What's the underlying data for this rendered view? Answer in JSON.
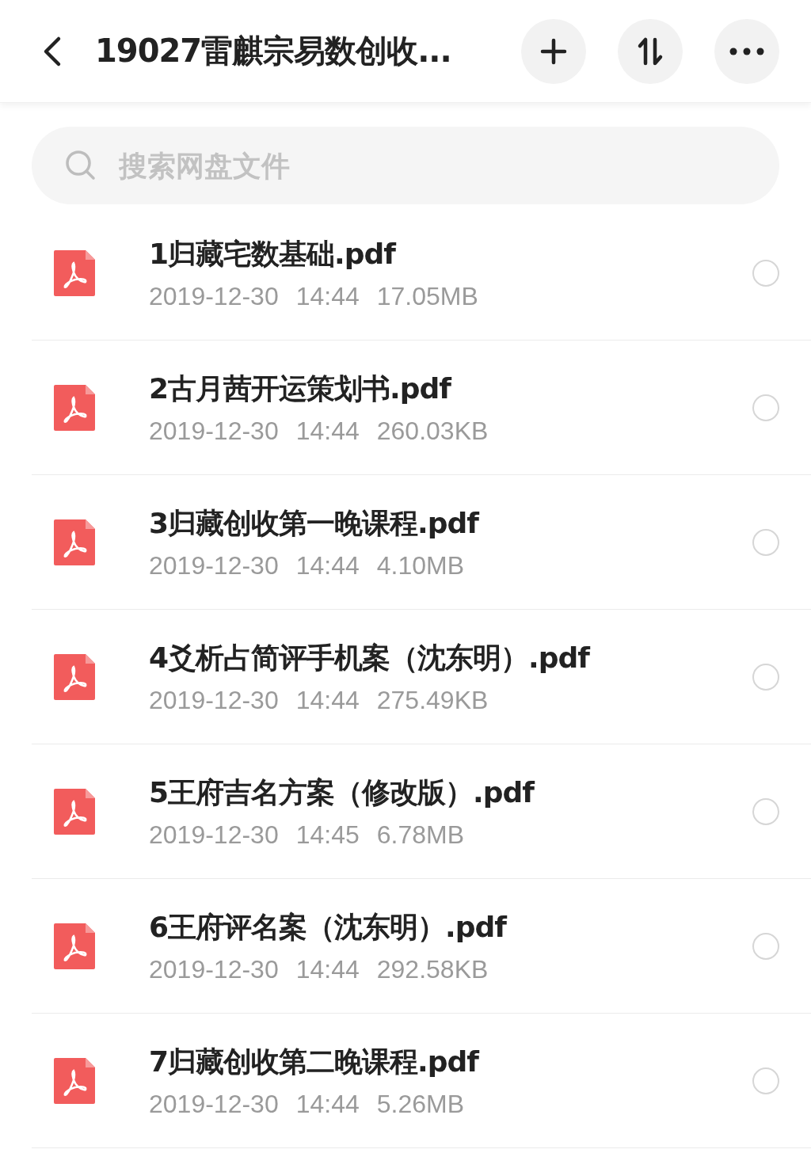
{
  "header": {
    "title": "19027雷麒宗易数创收..."
  },
  "search": {
    "placeholder": "搜索网盘文件"
  },
  "files": [
    {
      "name": "1归藏宅数基础.pdf",
      "date": "2019-12-30",
      "time": "14:44",
      "size": "17.05MB",
      "selected": false
    },
    {
      "name": "2古月茜开运策划书.pdf",
      "date": "2019-12-30",
      "time": "14:44",
      "size": "260.03KB",
      "selected": false
    },
    {
      "name": "3归藏创收第一晚课程.pdf",
      "date": "2019-12-30",
      "time": "14:44",
      "size": "4.10MB",
      "selected": false
    },
    {
      "name": "4爻析占简评手机案（沈东明）.pdf",
      "date": "2019-12-30",
      "time": "14:44",
      "size": "275.49KB",
      "selected": false
    },
    {
      "name": "5王府吉名方案（修改版）.pdf",
      "date": "2019-12-30",
      "time": "14:45",
      "size": "6.78MB",
      "selected": false
    },
    {
      "name": "6王府评名案（沈东明）.pdf",
      "date": "2019-12-30",
      "time": "14:44",
      "size": "292.58KB",
      "selected": false
    },
    {
      "name": "7归藏创收第二晚课程.pdf",
      "date": "2019-12-30",
      "time": "14:44",
      "size": "5.26MB",
      "selected": false
    }
  ]
}
